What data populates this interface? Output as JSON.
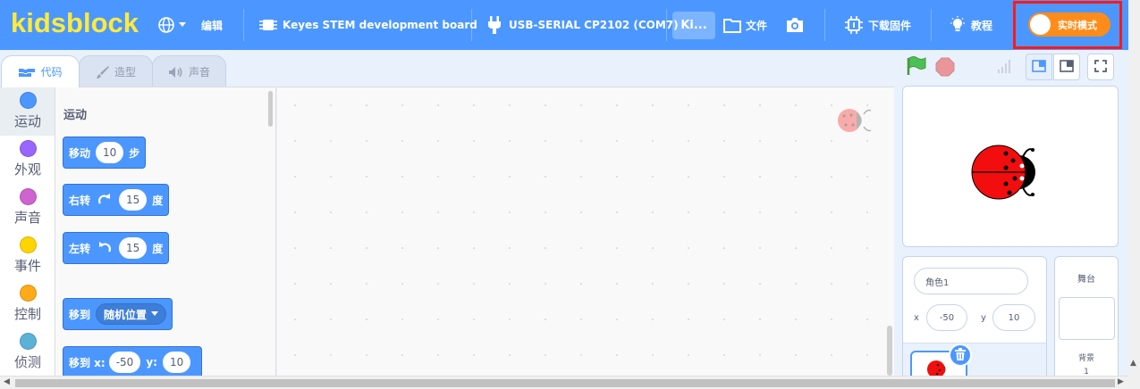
{
  "menubar": {
    "logo": "kidsblock",
    "language_icon": "globe-icon",
    "edit": "编辑",
    "board": "Keyes STEM development board",
    "port": "USB-SERIAL CP2102 (COM7)",
    "kit_short": "Ki...",
    "file": "文件",
    "camera_icon": "camera-icon",
    "firmware": "下载固件",
    "tutorial": "教程",
    "realtime_mode": "实时模式",
    "accent": "#4c97ff",
    "logo_color": "#ffeb3b",
    "toggle_color": "#ff8c1a",
    "highlight_color": "#ff1a1a"
  },
  "tabs": [
    {
      "label": "代码",
      "icon": "code-icon"
    },
    {
      "label": "造型",
      "icon": "brush-icon"
    },
    {
      "label": "声音",
      "icon": "speaker-icon"
    }
  ],
  "categories": [
    {
      "label": "运动",
      "color": "#4c97ff"
    },
    {
      "label": "外观",
      "color": "#9966ff"
    },
    {
      "label": "声音",
      "color": "#cf63cf"
    },
    {
      "label": "事件",
      "color": "#ffd500"
    },
    {
      "label": "控制",
      "color": "#ffab19"
    },
    {
      "label": "侦测",
      "color": "#5cb1d6"
    }
  ],
  "flyout": {
    "title": "运动",
    "move": {
      "prefix": "移动",
      "value": "10",
      "suffix": "步"
    },
    "turn_right": {
      "prefix": "右转",
      "value": "15",
      "suffix": "度"
    },
    "turn_left": {
      "prefix": "左转",
      "value": "15",
      "suffix": "度"
    },
    "goto": {
      "prefix": "移到",
      "option": "随机位置"
    },
    "goto_xy": {
      "prefix": "移到 x:",
      "x": "-50",
      "ylabel": "y:",
      "y": "10"
    }
  },
  "sprite": {
    "name": "角色1",
    "x_label": "x",
    "x": "-50",
    "y_label": "y",
    "y": "10"
  },
  "stage_panel": {
    "title": "舞台",
    "backdrop_label": "背景",
    "backdrop_count": "1"
  }
}
